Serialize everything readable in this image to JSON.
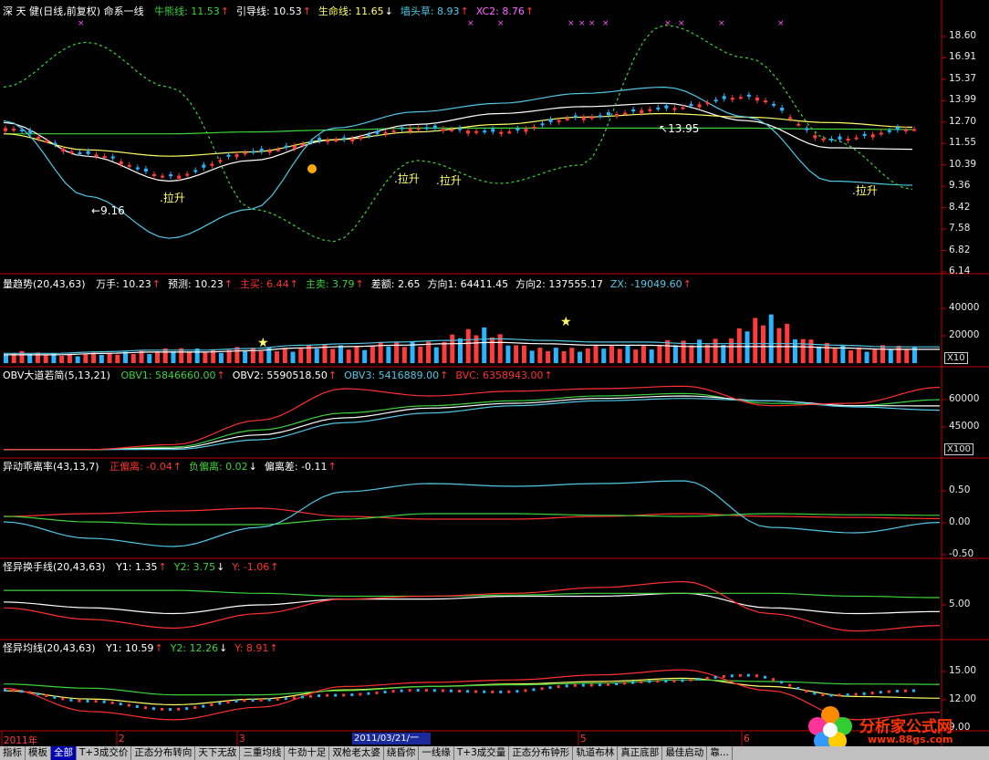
{
  "colors": {
    "up": "#ff3b3b",
    "down": "#28b4ff",
    "grid": "#8a0000",
    "axis": "#c00000",
    "white": "#ffffff",
    "yellow": "#ffff66",
    "green": "#3cd23c",
    "cyan": "#50c8e6",
    "red": "#ff3030"
  },
  "panel1": {
    "title": "深 天 健(日线,前复权) 命系一线",
    "items": [
      {
        "label": "牛熊线:",
        "value": "11.53",
        "arrow": "up",
        "color": "#3cd23c"
      },
      {
        "label": "引导线:",
        "value": "10.53",
        "arrow": "up",
        "color": "#ffffff"
      },
      {
        "label": "生命线:",
        "value": "11.65",
        "arrow": "down",
        "color": "#ffff66"
      },
      {
        "label": "墙头草:",
        "value": "8.93",
        "arrow": "up",
        "color": "#50c8e6"
      },
      {
        "label": "XC2:",
        "value": "8.76",
        "arrow": "up",
        "color": "#ff66ff"
      }
    ],
    "yticks": [
      "18.60",
      "16.91",
      "15.37",
      "13.99",
      "12.70",
      "11.55",
      "10.39",
      "9.36",
      "8.42",
      "7.58",
      "6.82",
      "6.14"
    ],
    "annotations": {
      "high": "13.95",
      "low": "9.16",
      "pull": ".拉升"
    }
  },
  "panel2": {
    "title": "量趋势(20,43,63)",
    "items": [
      {
        "label": "万手:",
        "value": "10.23",
        "arrow": "up",
        "color": "#ffffff"
      },
      {
        "label": "预测:",
        "value": "10.23",
        "arrow": "up",
        "color": "#ffffff"
      },
      {
        "label": "主买:",
        "value": "6.44",
        "arrow": "up",
        "color": "#ff3030"
      },
      {
        "label": "主卖:",
        "value": "3.79",
        "arrow": "up",
        "color": "#3cd23c"
      },
      {
        "label": "差额:",
        "value": "2.65",
        "arrow": "",
        "color": "#ffffff"
      },
      {
        "label": "方向1:",
        "value": "64411.45",
        "arrow": "",
        "color": "#ffffff"
      },
      {
        "label": "方向2:",
        "value": "137555.17",
        "arrow": "",
        "color": "#ffffff"
      },
      {
        "label": "ZX:",
        "value": "-19049.60",
        "arrow": "up",
        "color": "#50c8e6"
      }
    ],
    "yticks": [
      "40000",
      "20000"
    ],
    "mult": "X10"
  },
  "panel3": {
    "title": "OBV大道若简(5,13,21)",
    "items": [
      {
        "label": "OBV1:",
        "value": "5846660.00",
        "arrow": "up",
        "color": "#3cd23c"
      },
      {
        "label": "OBV2:",
        "value": "5590518.50",
        "arrow": "up",
        "color": "#ffffff"
      },
      {
        "label": "OBV3:",
        "value": "5416889.00",
        "arrow": "up",
        "color": "#50c8e6"
      },
      {
        "label": "BVC:",
        "value": "6358943.00",
        "arrow": "up",
        "color": "#ff3030"
      }
    ],
    "yticks": [
      "60000",
      "45000"
    ],
    "mult": "X100"
  },
  "panel4": {
    "title": "异动乖离率(43,13,7)",
    "items": [
      {
        "label": "正偏离:",
        "value": "-0.04",
        "arrow": "up",
        "color": "#ff3030"
      },
      {
        "label": "负偏离:",
        "value": "0.02",
        "arrow": "down",
        "color": "#3cd23c"
      },
      {
        "label": "偏离差:",
        "value": "-0.11",
        "arrow": "up",
        "color": "#ffffff"
      }
    ],
    "yticks": [
      "0.50",
      "0.00",
      "-0.50"
    ]
  },
  "panel5": {
    "title": "怪异换手线(20,43,63)",
    "items": [
      {
        "label": "Y1:",
        "value": "1.35",
        "arrow": "up",
        "color": "#ffffff"
      },
      {
        "label": "Y2:",
        "value": "3.75",
        "arrow": "down",
        "color": "#3cd23c"
      },
      {
        "label": "Y:",
        "value": "-1.06",
        "arrow": "up",
        "color": "#ff3030"
      }
    ],
    "yticks": [
      "5.00"
    ]
  },
  "panel6": {
    "title": "怪异均线(20,43,63)",
    "items": [
      {
        "label": "Y1:",
        "value": "10.59",
        "arrow": "up",
        "color": "#ffffff"
      },
      {
        "label": "Y2:",
        "value": "12.26",
        "arrow": "down",
        "color": "#3cd23c"
      },
      {
        "label": "Y:",
        "value": "8.91",
        "arrow": "up",
        "color": "#ff3030"
      }
    ],
    "yticks": [
      "15.00",
      "12.00",
      "9.00"
    ]
  },
  "xaxis": {
    "labels": [
      "2011年",
      "2",
      "3",
      "4",
      "5",
      "6"
    ],
    "selected_date": "2011/03/21/一"
  },
  "tabs": [
    "指标",
    "模板",
    "全部",
    "T+3成交价",
    "正态分布转向",
    "天下无敌",
    "三重均线",
    "牛劲十足",
    "双枪老太婆",
    "绕昏你",
    "一线缘",
    "T+3成交量",
    "正态分布钟形",
    "轨道布林",
    "真正底部",
    "最佳启动",
    "靠..."
  ],
  "active_tab": "全部",
  "logo": {
    "name": "分析家公式网",
    "url": "www.88gs.com"
  },
  "chart_data": {
    "type": "line",
    "title": "深 天 健(日线,前复权) 命系一线",
    "x": [
      "2011年",
      "2",
      "3",
      "4",
      "5",
      "6"
    ],
    "ylim": [
      6.14,
      18.6
    ],
    "series": [
      {
        "name": "牛熊线",
        "values": [
          11.3,
          11.3,
          11.3,
          11.4,
          11.5,
          11.6,
          11.6,
          11.6,
          11.6,
          11.6,
          11.55,
          11.53
        ]
      },
      {
        "name": "引导线",
        "values": [
          11.9,
          10.2,
          9.1,
          10.0,
          11.0,
          11.8,
          12.4,
          12.8,
          13.0,
          12.0,
          10.6,
          10.53
        ]
      },
      {
        "name": "生命线",
        "values": [
          11.3,
          10.5,
          10.2,
          10.4,
          11.0,
          11.4,
          11.8,
          12.2,
          12.4,
          12.2,
          11.9,
          11.65
        ]
      },
      {
        "name": "墙头草",
        "values": [
          12.0,
          8.5,
          7.0,
          8.0,
          11.6,
          12.5,
          13.0,
          13.6,
          14.0,
          12.2,
          9.1,
          8.93
        ]
      },
      {
        "name": "XC2",
        "values": [
          14.0,
          17.2,
          14.0,
          8.0,
          6.9,
          10.0,
          9.0,
          9.8,
          18.6,
          16.0,
          11.0,
          8.76
        ]
      },
      {
        "name": "收盘",
        "values": [
          11.6,
          10.3,
          9.3,
          10.4,
          11.0,
          11.6,
          11.4,
          12.2,
          12.7,
          13.4,
          11.0,
          11.55
        ]
      }
    ],
    "panels": [
      {
        "name": "量趋势(20,43,63)",
        "type": "bar",
        "series": [
          {
            "name": "万手",
            "values": [
              7,
              6,
              6,
              8,
              9,
              9,
              10,
              11,
              12,
              14,
              22,
              9,
              10,
              11,
              13,
              16,
              30,
              12,
              10,
              10.23
            ]
          },
          {
            "name": "方向1",
            "values": [
              6,
              6,
              7,
              8,
              8,
              9,
              11,
              12,
              13,
              14,
              15,
              14,
              13,
              13,
              12,
              12,
              12,
              11,
              10,
              10
            ]
          }
        ]
      },
      {
        "name": "OBV大道若简(5,13,21)",
        "series": [
          {
            "name": "OBV1",
            "values": [
              38000,
              38000,
              39000,
              46000,
              53000,
              56000,
              58000,
              60000,
              61000,
              57000,
              56000,
              58466
            ]
          },
          {
            "name": "OBV2",
            "values": [
              38000,
              38000,
              38500,
              44000,
              51000,
              55000,
              57000,
              59000,
              60000,
              58000,
              56000,
              55905
            ]
          },
          {
            "name": "OBV3",
            "values": [
              38000,
              38000,
              38000,
              42000,
              49000,
              53000,
              56000,
              58000,
              59000,
              58000,
              55500,
              54168
            ]
          },
          {
            "name": "BVC",
            "values": [
              38000,
              38000,
              40000,
              50000,
              63000,
              60000,
              62000,
              63000,
              64000,
              56000,
              57000,
              63589
            ]
          }
        ]
      },
      {
        "name": "异动乖离率(43,13,7)",
        "series": [
          {
            "name": "正偏离",
            "values": [
              0.0,
              0.05,
              0.1,
              0.15,
              0.0,
              -0.05,
              -0.05,
              0.0,
              0.05,
              0.0,
              -0.02,
              -0.04
            ]
          },
          {
            "name": "负偏离",
            "values": [
              0.0,
              -0.1,
              -0.15,
              -0.15,
              -0.05,
              0.05,
              0.05,
              0.02,
              0.0,
              0.05,
              0.03,
              0.02
            ]
          },
          {
            "name": "偏离差",
            "values": [
              -0.1,
              -0.4,
              -0.55,
              -0.2,
              0.45,
              0.6,
              0.55,
              0.6,
              0.65,
              -0.2,
              -0.3,
              -0.11
            ]
          }
        ]
      },
      {
        "name": "怪异换手线(20,43,63)",
        "series": [
          {
            "name": "Y1",
            "values": [
              3,
              2,
              1,
              2.5,
              3.5,
              3.5,
              4,
              4,
              4.5,
              2,
              1,
              1.35
            ]
          },
          {
            "name": "Y2",
            "values": [
              5,
              5,
              5,
              4.5,
              4,
              4,
              4.2,
              4.5,
              4.5,
              4.5,
              4,
              3.75
            ]
          },
          {
            "name": "Y",
            "values": [
              2,
              0,
              -1.5,
              1,
              3.5,
              4,
              4.5,
              5.5,
              6.5,
              1,
              -2,
              -1.06
            ]
          }
        ]
      },
      {
        "name": "怪异均线(20,43,63)",
        "series": [
          {
            "name": "Y1",
            "values": [
              11.5,
              10.5,
              9.8,
              10.5,
              11.6,
              12.0,
              12.3,
              12.6,
              13.0,
              12.0,
              10.8,
              10.59
            ]
          },
          {
            "name": "Y2",
            "values": [
              12.3,
              11.8,
              11.0,
              11.0,
              11.5,
              12.0,
              12.2,
              12.4,
              12.8,
              12.6,
              12.3,
              12.26
            ]
          },
          {
            "name": "Y",
            "values": [
              11.8,
              9.0,
              8.0,
              9.5,
              12.0,
              12.5,
              12.8,
              13.4,
              14.0,
              11.5,
              8.0,
              8.91
            ]
          }
        ]
      }
    ]
  }
}
